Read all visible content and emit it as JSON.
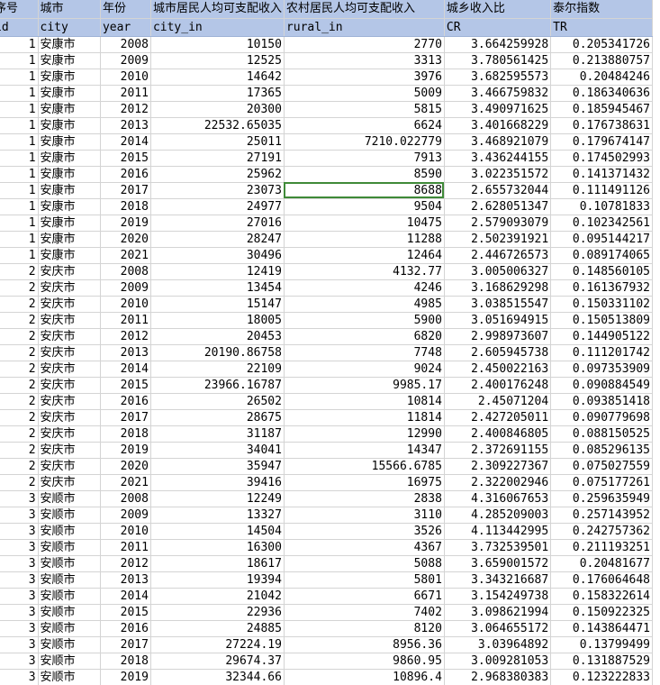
{
  "header_row1": [
    "序号",
    "城市",
    "年份",
    "城市居民人均可支配收入",
    "农村居民人均可支配收入",
    "城乡收入比",
    "泰尔指数"
  ],
  "header_row2": [
    "id",
    "city",
    "year",
    "city_in",
    "rural_in",
    "CR",
    "TR"
  ],
  "selected_row": 9,
  "selected_col": 4,
  "rows": [
    [
      "1",
      "安康市",
      "2008",
      "10150",
      "2770",
      "3.664259928",
      "0.205341726"
    ],
    [
      "1",
      "安康市",
      "2009",
      "12525",
      "3313",
      "3.780561425",
      "0.213880757"
    ],
    [
      "1",
      "安康市",
      "2010",
      "14642",
      "3976",
      "3.682595573",
      "0.20484246"
    ],
    [
      "1",
      "安康市",
      "2011",
      "17365",
      "5009",
      "3.466759832",
      "0.186340636"
    ],
    [
      "1",
      "安康市",
      "2012",
      "20300",
      "5815",
      "3.490971625",
      "0.185945467"
    ],
    [
      "1",
      "安康市",
      "2013",
      "22532.65035",
      "6624",
      "3.401668229",
      "0.176738631"
    ],
    [
      "1",
      "安康市",
      "2014",
      "25011",
      "7210.022779",
      "3.468921079",
      "0.179674147"
    ],
    [
      "1",
      "安康市",
      "2015",
      "27191",
      "7913",
      "3.436244155",
      "0.174502993"
    ],
    [
      "1",
      "安康市",
      "2016",
      "25962",
      "8590",
      "3.022351572",
      "0.141371432"
    ],
    [
      "1",
      "安康市",
      "2017",
      "23073",
      "8688",
      "2.655732044",
      "0.111491126"
    ],
    [
      "1",
      "安康市",
      "2018",
      "24977",
      "9504",
      "2.628051347",
      "0.10781833"
    ],
    [
      "1",
      "安康市",
      "2019",
      "27016",
      "10475",
      "2.579093079",
      "0.102342561"
    ],
    [
      "1",
      "安康市",
      "2020",
      "28247",
      "11288",
      "2.502391921",
      "0.095144217"
    ],
    [
      "1",
      "安康市",
      "2021",
      "30496",
      "12464",
      "2.446726573",
      "0.089174065"
    ],
    [
      "2",
      "安庆市",
      "2008",
      "12419",
      "4132.77",
      "3.005006327",
      "0.148560105"
    ],
    [
      "2",
      "安庆市",
      "2009",
      "13454",
      "4246",
      "3.168629298",
      "0.161367932"
    ],
    [
      "2",
      "安庆市",
      "2010",
      "15147",
      "4985",
      "3.038515547",
      "0.150331102"
    ],
    [
      "2",
      "安庆市",
      "2011",
      "18005",
      "5900",
      "3.051694915",
      "0.150513809"
    ],
    [
      "2",
      "安庆市",
      "2012",
      "20453",
      "6820",
      "2.998973607",
      "0.144905122"
    ],
    [
      "2",
      "安庆市",
      "2013",
      "20190.86758",
      "7748",
      "2.605945738",
      "0.111201742"
    ],
    [
      "2",
      "安庆市",
      "2014",
      "22109",
      "9024",
      "2.450022163",
      "0.097353909"
    ],
    [
      "2",
      "安庆市",
      "2015",
      "23966.16787",
      "9985.17",
      "2.400176248",
      "0.090884549"
    ],
    [
      "2",
      "安庆市",
      "2016",
      "26502",
      "10814",
      "2.45071204",
      "0.093851418"
    ],
    [
      "2",
      "安庆市",
      "2017",
      "28675",
      "11814",
      "2.427205011",
      "0.090779698"
    ],
    [
      "2",
      "安庆市",
      "2018",
      "31187",
      "12990",
      "2.400846805",
      "0.088150525"
    ],
    [
      "2",
      "安庆市",
      "2019",
      "34041",
      "14347",
      "2.372691155",
      "0.085296135"
    ],
    [
      "2",
      "安庆市",
      "2020",
      "35947",
      "15566.6785",
      "2.309227367",
      "0.075027559"
    ],
    [
      "2",
      "安庆市",
      "2021",
      "39416",
      "16975",
      "2.322002946",
      "0.075177261"
    ],
    [
      "3",
      "安顺市",
      "2008",
      "12249",
      "2838",
      "4.316067653",
      "0.259635949"
    ],
    [
      "3",
      "安顺市",
      "2009",
      "13327",
      "3110",
      "4.285209003",
      "0.257143952"
    ],
    [
      "3",
      "安顺市",
      "2010",
      "14504",
      "3526",
      "4.113442995",
      "0.242757362"
    ],
    [
      "3",
      "安顺市",
      "2011",
      "16300",
      "4367",
      "3.732539501",
      "0.211193251"
    ],
    [
      "3",
      "安顺市",
      "2012",
      "18617",
      "5088",
      "3.659001572",
      "0.20481677"
    ],
    [
      "3",
      "安顺市",
      "2013",
      "19394",
      "5801",
      "3.343216687",
      "0.176064648"
    ],
    [
      "3",
      "安顺市",
      "2014",
      "21042",
      "6671",
      "3.154249738",
      "0.158322614"
    ],
    [
      "3",
      "安顺市",
      "2015",
      "22936",
      "7402",
      "3.098621994",
      "0.150922325"
    ],
    [
      "3",
      "安顺市",
      "2016",
      "24885",
      "8120",
      "3.064655172",
      "0.143864471"
    ],
    [
      "3",
      "安顺市",
      "2017",
      "27224.19",
      "8956.36",
      "3.03964892",
      "0.13799499"
    ],
    [
      "3",
      "安顺市",
      "2018",
      "29674.37",
      "9860.95",
      "3.009281053",
      "0.131887529"
    ],
    [
      "3",
      "安顺市",
      "2019",
      "32344.66",
      "10896.4",
      "2.968380383",
      "0.123222833"
    ]
  ]
}
